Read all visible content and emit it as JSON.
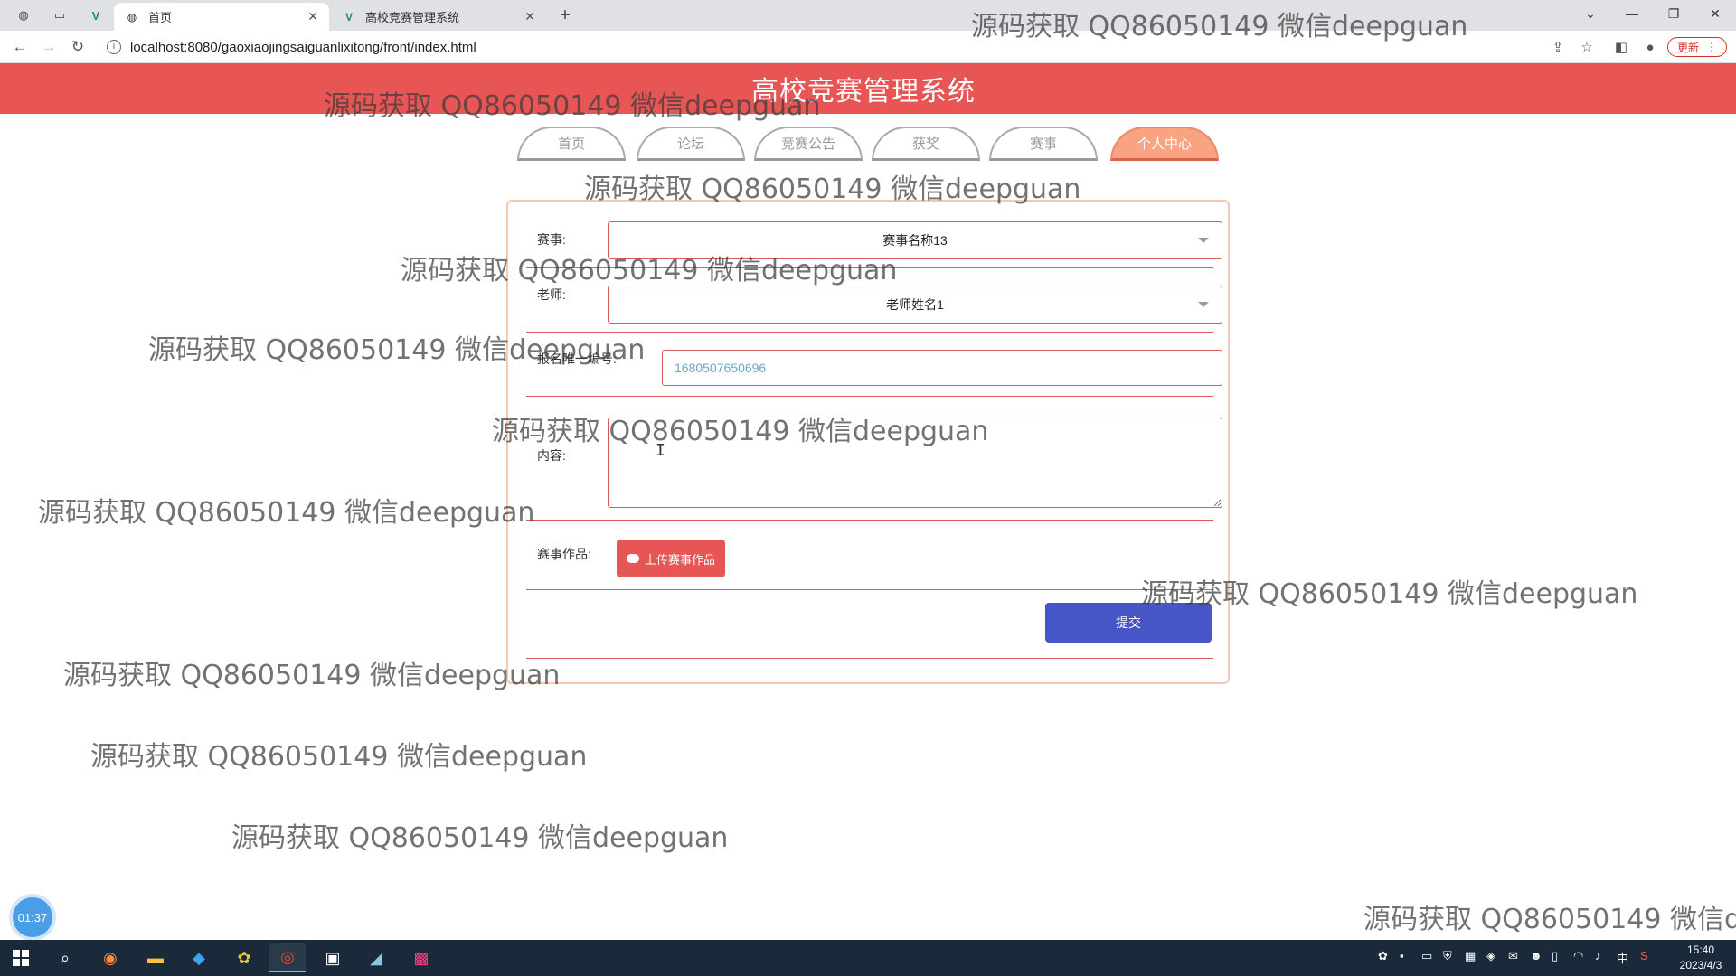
{
  "browser": {
    "tabs": [
      {
        "title": "首页",
        "active": true
      },
      {
        "title": "高校竞赛管理系统",
        "active": false
      }
    ],
    "url": "localhost:8080/gaoxiaojingsaiguanlixitong/front/index.html",
    "update_label": "更新"
  },
  "site": {
    "title": "高校竞赛管理系统",
    "nav": [
      {
        "label": "首页",
        "active": false
      },
      {
        "label": "论坛",
        "active": false
      },
      {
        "label": "竞赛公告",
        "active": false
      },
      {
        "label": "获奖",
        "active": false
      },
      {
        "label": "赛事",
        "active": false
      },
      {
        "label": "个人中心",
        "active": true
      }
    ]
  },
  "form": {
    "event_label": "赛事:",
    "event_value": "赛事名称13",
    "teacher_label": "老师:",
    "teacher_value": "老师姓名1",
    "regno_label": "报名唯一编号:",
    "regno_placeholder": "1680507650696",
    "content_label": "内容:",
    "work_label": "赛事作品:",
    "upload_label": "上传赛事作品",
    "submit_label": "提交"
  },
  "timer": "01:37",
  "watermark": "源码获取 QQ86050149 微信deepguan",
  "taskbar": {
    "time": "15:40",
    "date": "2023/4/3",
    "ime": "中"
  },
  "colors": {
    "header_red": "#e85555",
    "active_nav": "#f9a382",
    "submit_blue": "#4756c6"
  }
}
